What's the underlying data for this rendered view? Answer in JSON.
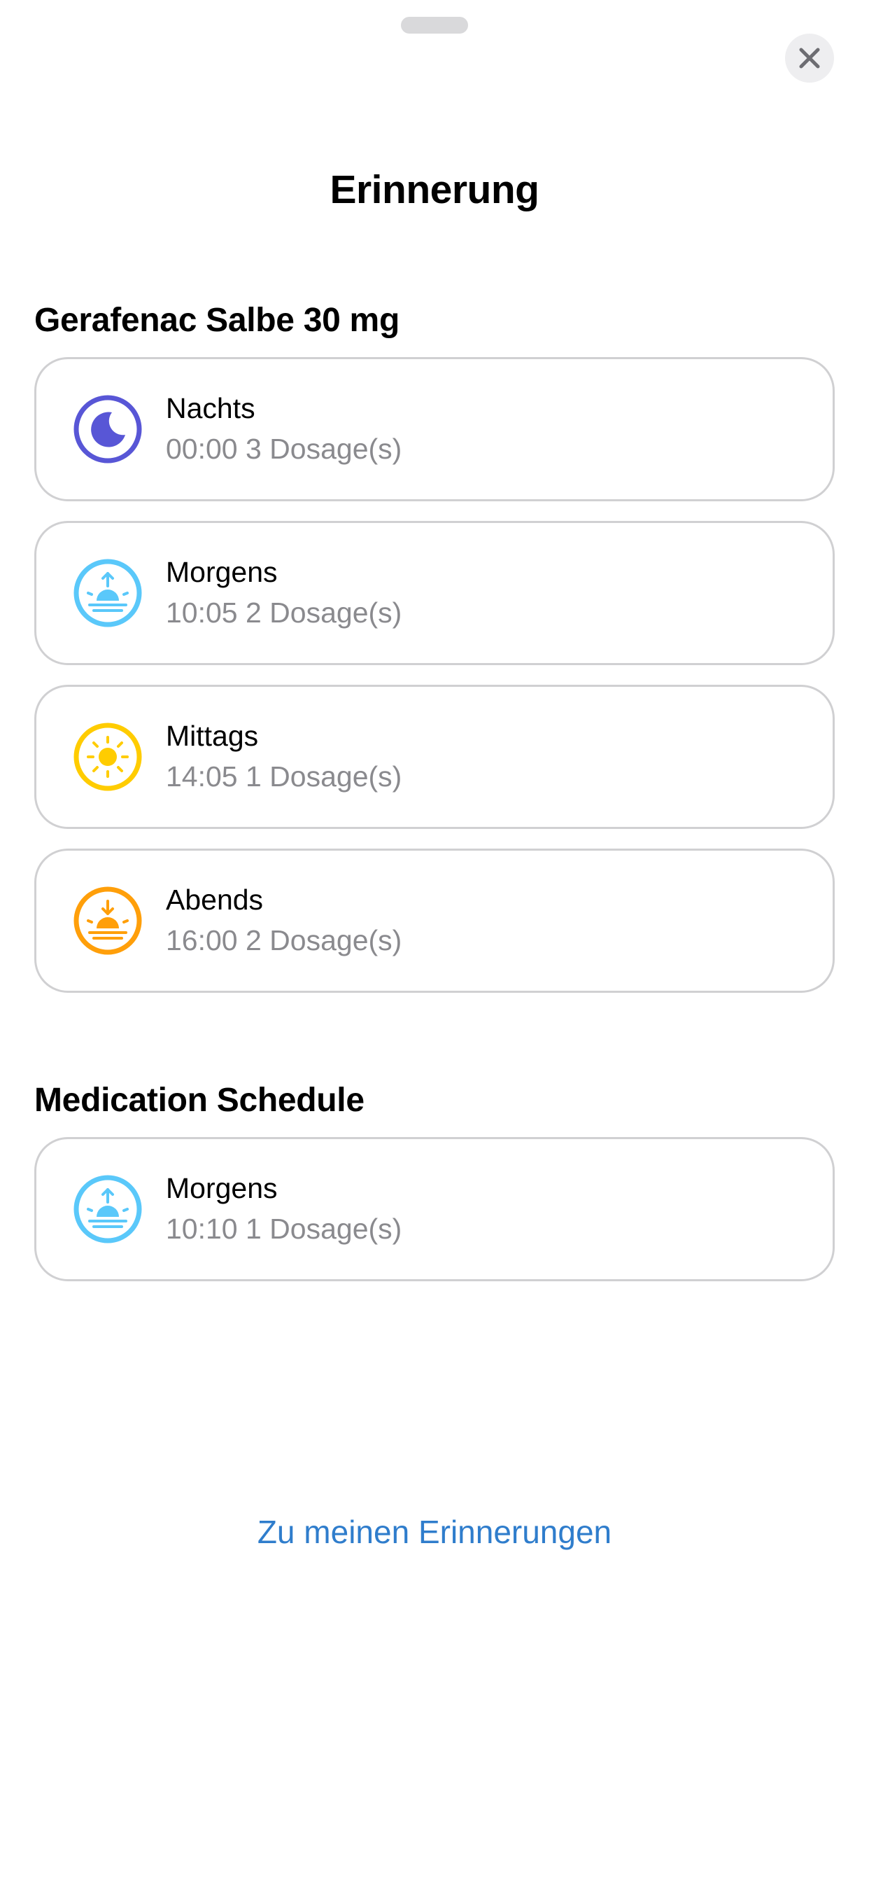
{
  "sheet": {
    "title": "Erinnerung",
    "close_icon": "close-icon"
  },
  "sections": [
    {
      "title": "Gerafenac Salbe 30 mg",
      "items": [
        {
          "label": "Nachts",
          "detail": "00:00 3 Dosage(s)",
          "icon": "moon-icon",
          "color": "#5856d6"
        },
        {
          "label": "Morgens",
          "detail": "10:05 2 Dosage(s)",
          "icon": "sunrise-icon",
          "color": "#5ac8fa"
        },
        {
          "label": "Mittags",
          "detail": "14:05 1 Dosage(s)",
          "icon": "sun-icon",
          "color": "#ffcc00"
        },
        {
          "label": "Abends",
          "detail": "16:00 2 Dosage(s)",
          "icon": "sunset-icon",
          "color": "#ff9f0a"
        }
      ]
    },
    {
      "title": "Medication Schedule",
      "items": [
        {
          "label": "Morgens",
          "detail": "10:10 1 Dosage(s)",
          "icon": "sunrise-icon",
          "color": "#5ac8fa"
        }
      ]
    }
  ],
  "footer": {
    "link_label": "Zu meinen Erinnerungen",
    "link_color": "#2f7dcc"
  }
}
